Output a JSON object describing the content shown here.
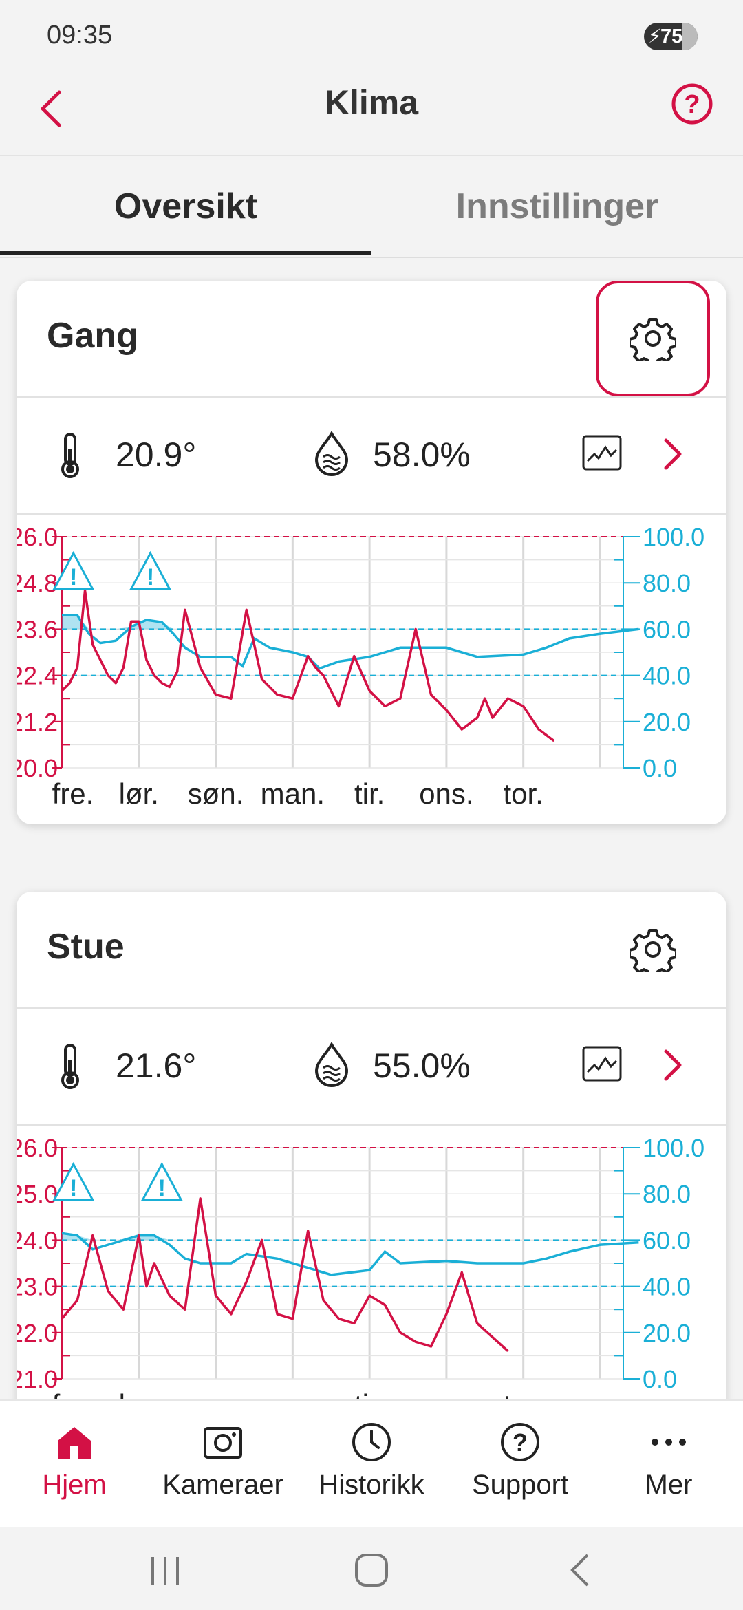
{
  "status": {
    "time": "09:35",
    "battery": "75"
  },
  "header": {
    "title": "Klima"
  },
  "tabs": [
    {
      "label": "Oversikt",
      "active": true
    },
    {
      "label": "Innstillinger",
      "active": false
    }
  ],
  "colors": {
    "accent": "#d31145",
    "temperature": "#d31145",
    "humidity": "#1aafd6"
  },
  "rooms": [
    {
      "name": "Gang",
      "temperature": "20.9°",
      "humidity": "58.0%",
      "gear_highlighted": true,
      "chart_data": {
        "type": "line",
        "categories": [
          "fre.",
          "lør.",
          "søn.",
          "man.",
          "tir.",
          "ons.",
          "tor."
        ],
        "y_left_ticks": [
          "26.0",
          "24.8",
          "23.6",
          "22.4",
          "21.2",
          "20.0"
        ],
        "y_right_ticks": [
          "100.0",
          "80.0",
          "60.0",
          "40.0",
          "20.0",
          "0.0"
        ],
        "ylim_left": [
          20,
          26
        ],
        "ylim_right": [
          0,
          100
        ],
        "thresholds_left": [
          26.0
        ],
        "thresholds_right": [
          60,
          40
        ],
        "warnings": [
          0.15,
          1.15
        ],
        "series": [
          {
            "axis": "left",
            "color": "#d31145",
            "x": [
              0,
              0.1,
              0.2,
              0.3,
              0.4,
              0.5,
              0.6,
              0.7,
              0.8,
              0.9,
              1.0,
              1.1,
              1.2,
              1.3,
              1.4,
              1.5,
              1.6,
              1.8,
              2.0,
              2.2,
              2.4,
              2.6,
              2.8,
              3.0,
              3.2,
              3.3,
              3.4,
              3.6,
              3.8,
              4.0,
              4.2,
              4.4,
              4.6,
              4.8,
              5.0,
              5.2,
              5.4,
              5.5,
              5.6,
              5.8,
              6.0,
              6.2,
              6.4,
              6.6,
              6.8,
              7.0,
              7.2,
              7.4,
              7.5
            ],
            "values": [
              22.0,
              22.2,
              22.6,
              24.6,
              23.2,
              22.8,
              22.4,
              22.2,
              22.6,
              23.8,
              23.8,
              22.8,
              22.4,
              22.2,
              22.1,
              22.5,
              24.1,
              22.6,
              21.9,
              21.8,
              24.1,
              22.3,
              21.9,
              21.8,
              22.9,
              22.6,
              22.4,
              21.6,
              22.9,
              22.0,
              21.6,
              21.8,
              23.6,
              21.9,
              21.5,
              21.0,
              21.3,
              21.8,
              21.3,
              21.8,
              21.6,
              21.0,
              20.7
            ]
          }
        ]
      }
    },
    {
      "name": "Stue",
      "temperature": "21.6°",
      "humidity": "55.0%",
      "gear_highlighted": false,
      "chart_data": {
        "type": "line",
        "categories": [
          "fre.",
          "lør.",
          "søn.",
          "man.",
          "tir.",
          "ons.",
          "tor."
        ],
        "y_left_ticks": [
          "26.0",
          "25.0",
          "24.0",
          "23.0",
          "22.0",
          "21.0"
        ],
        "y_right_ticks": [
          "100.0",
          "80.0",
          "60.0",
          "40.0",
          "20.0",
          "0.0"
        ],
        "ylim_left": [
          21,
          26
        ],
        "ylim_right": [
          0,
          100
        ],
        "thresholds_left": [
          26.0
        ],
        "thresholds_right": [
          60,
          40
        ],
        "warnings": [
          0.15,
          1.3
        ],
        "series": [
          {
            "axis": "left",
            "color": "#d31145",
            "x": [
              0,
              0.2,
              0.4,
              0.6,
              0.8,
              1.0,
              1.1,
              1.2,
              1.4,
              1.6,
              1.8,
              2.0,
              2.2,
              2.4,
              2.6,
              2.8,
              3.0,
              3.2,
              3.4,
              3.6,
              3.8,
              4.0,
              4.2,
              4.4,
              4.6,
              4.8,
              5.0,
              5.2,
              5.4,
              5.6,
              5.8,
              6.0,
              6.2,
              6.4,
              6.6,
              6.8,
              7.0
            ],
            "values": [
              22.3,
              22.7,
              24.1,
              22.9,
              22.5,
              24.1,
              23.0,
              23.5,
              22.8,
              22.5,
              24.9,
              22.8,
              22.4,
              23.1,
              24.0,
              22.4,
              22.3,
              24.2,
              22.7,
              22.3,
              22.2,
              22.8,
              22.6,
              22.0,
              21.8,
              21.7,
              22.4,
              23.3,
              22.2,
              21.9,
              21.6
            ]
          }
        ]
      }
    }
  ],
  "nav": [
    {
      "label": "Hjem",
      "icon": "home-icon",
      "active": true
    },
    {
      "label": "Kameraer",
      "icon": "camera-icon",
      "active": false
    },
    {
      "label": "Historikk",
      "icon": "history-icon",
      "active": false
    },
    {
      "label": "Support",
      "icon": "support-icon",
      "active": false
    },
    {
      "label": "Mer",
      "icon": "more-icon",
      "active": false
    }
  ]
}
